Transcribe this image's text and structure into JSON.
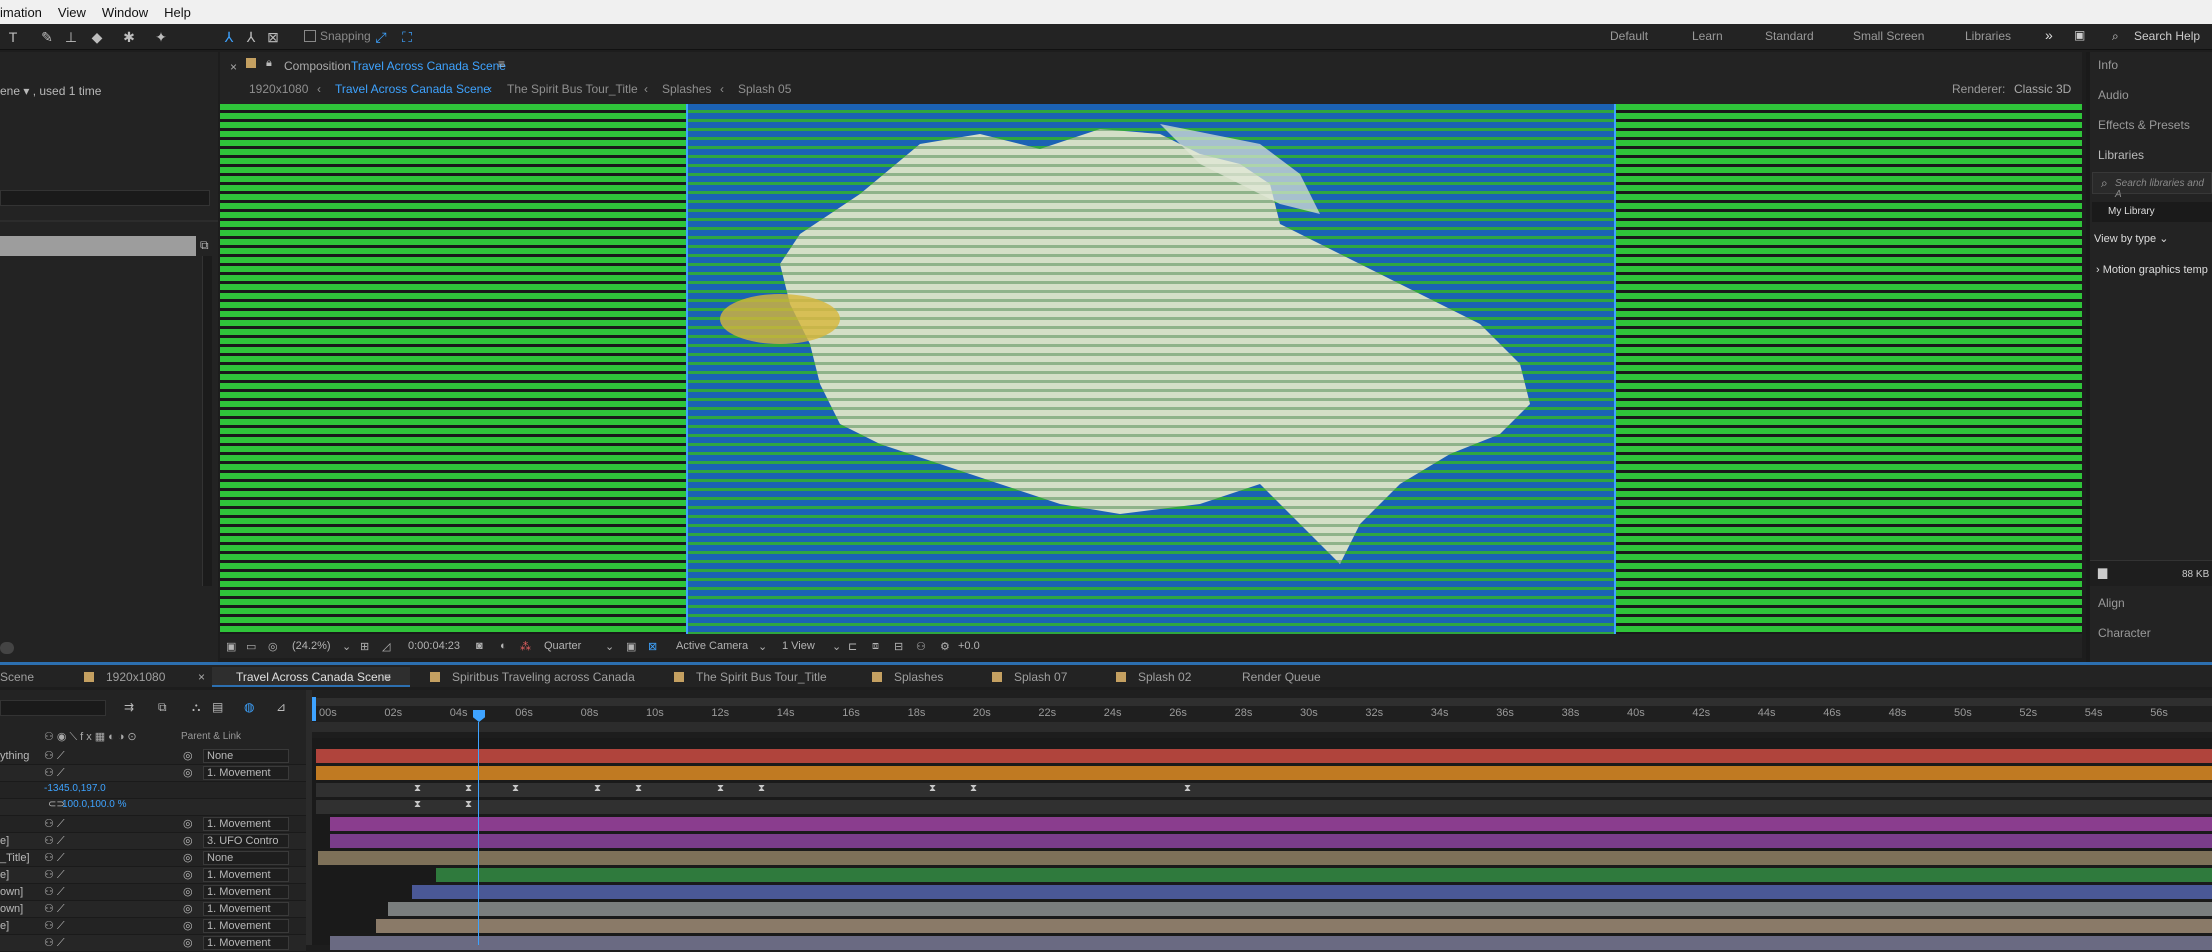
{
  "menu": [
    "imation",
    "View",
    "Window",
    "Help"
  ],
  "toolbar": {
    "snapping_label": "Snapping"
  },
  "workspaces": [
    "Default",
    "Learn",
    "Standard",
    "Small Screen",
    "Libraries"
  ],
  "search_help": "Search Help",
  "project": {
    "used_text": "ene ▾ , used 1 time"
  },
  "composition": {
    "panel_prefix": "Composition",
    "name": "Travel Across Canada Scene",
    "breadcrumbs": [
      "1920x1080",
      "Travel Across Canada Scene",
      "The Spirit Bus Tour_Title",
      "Splashes",
      "Splash 05"
    ],
    "renderer_label": "Renderer:",
    "renderer_value": "Classic 3D"
  },
  "viewer": {
    "zoom": "(24.2%)",
    "timecode": "0:00:04:23",
    "resolution": "Quarter",
    "camera": "Active Camera",
    "views": "1 View",
    "exposure": "+0.0"
  },
  "right_panel": {
    "items": [
      "Info",
      "Audio",
      "Effects & Presets",
      "Libraries"
    ],
    "search_placeholder": "Search libraries and A",
    "my_library": "My Library",
    "view_by": "View by type",
    "motion_graphics": "Motion graphics temp",
    "size": "88 KB",
    "bottom_items": [
      "Align",
      "Character"
    ]
  },
  "timeline": {
    "tabs": [
      "Scene",
      "1920x1080",
      "Travel Across Canada Scene",
      "Spiritbus Traveling across Canada",
      "The Spirit Bus Tour_Title",
      "Splashes",
      "Splash 07",
      "Splash 02",
      "Render Queue"
    ],
    "ruler": [
      "00s",
      "02s",
      "04s",
      "06s",
      "08s",
      "10s",
      "12s",
      "14s",
      "16s",
      "18s",
      "20s",
      "22s",
      "24s",
      "26s",
      "28s",
      "30s",
      "32s",
      "34s",
      "36s",
      "38s",
      "40s",
      "42s",
      "44s",
      "46s",
      "48s",
      "50s",
      "52s",
      "54s",
      "56s"
    ],
    "parent_header": "Parent & Link",
    "position_value": "-1345.0,197.0",
    "scale_value": "100.0,100.0 %",
    "layers": [
      {
        "name": "ything",
        "parent": "None",
        "color": "#b0443c"
      },
      {
        "name": "",
        "parent": "1. Movement",
        "color": "#c07a22"
      },
      {
        "name": "",
        "parent": "",
        "color": ""
      },
      {
        "name": "",
        "parent": "",
        "color": ""
      },
      {
        "name": "",
        "parent": "1. Movement",
        "color": "#8a3d8e"
      },
      {
        "name": "e]",
        "parent": "3. UFO Contro",
        "color": "#7a3d8a"
      },
      {
        "name": "_Title]",
        "parent": "None",
        "color": "#7e7159"
      },
      {
        "name": "e]",
        "parent": "1. Movement",
        "color": "#2f7a3d"
      },
      {
        "name": "own]",
        "parent": "1. Movement",
        "color": "#4a5896"
      },
      {
        "name": "own]",
        "parent": "1. Movement",
        "color": "#7a7e7e"
      },
      {
        "name": "e]",
        "parent": "1. Movement",
        "color": "#8a7a68"
      },
      {
        "name": "",
        "parent": "1. Movement",
        "color": "#6a6a82"
      }
    ]
  },
  "colors": {
    "accent": "#3ea3ff",
    "stripe_green": "#2fc53a",
    "stripe_blue": "#1b62b4"
  }
}
